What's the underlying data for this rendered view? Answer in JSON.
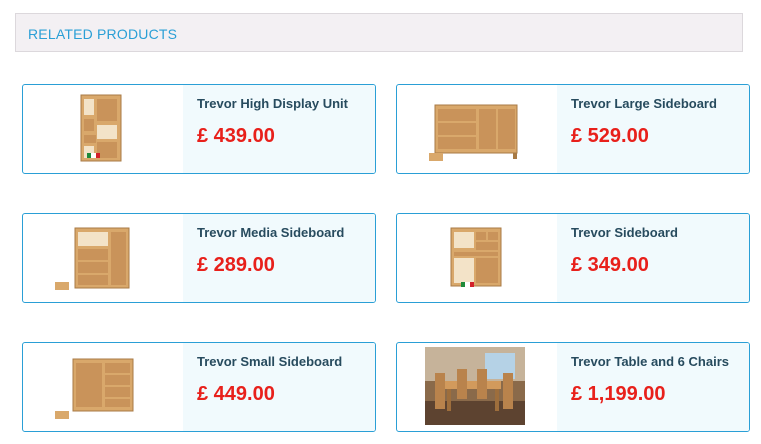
{
  "section": {
    "title": "RELATED PRODUCTS"
  },
  "products": [
    {
      "name": "Trevor High Display Unit",
      "price": "£ 439.00",
      "image_kind": "display-unit"
    },
    {
      "name": "Trevor Large Sideboard",
      "price": "£ 529.00",
      "image_kind": "large-sideboard"
    },
    {
      "name": "Trevor Media Sideboard",
      "price": "£ 289.00",
      "image_kind": "media-sideboard"
    },
    {
      "name": "Trevor Sideboard",
      "price": "£ 349.00",
      "image_kind": "sideboard"
    },
    {
      "name": "Trevor Small Sideboard",
      "price": "£ 449.00",
      "image_kind": "small-sideboard"
    },
    {
      "name": "Trevor Table and 6 Chairs",
      "price": "£ 1,199.00",
      "image_kind": "dining-room-photo"
    }
  ],
  "colors": {
    "accent_blue": "#2a9fd6",
    "price_red": "#e8201b",
    "title_navy": "#274b5e",
    "wood": "#d9a86b"
  }
}
